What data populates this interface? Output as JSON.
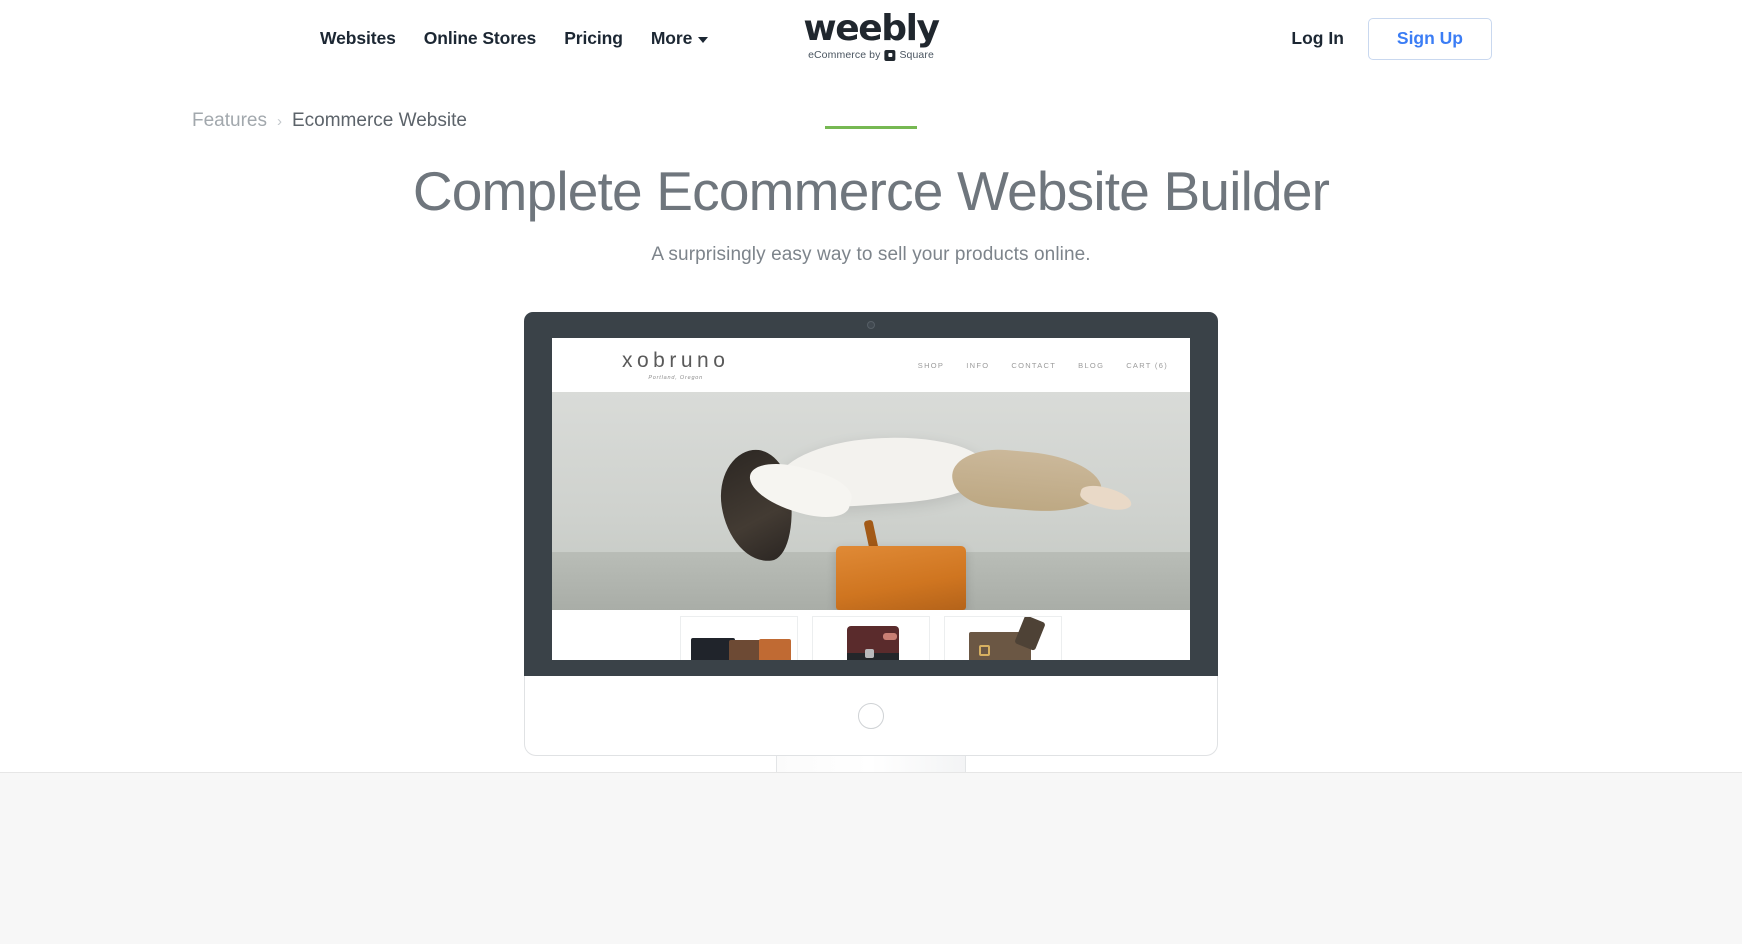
{
  "topnav": {
    "links": [
      {
        "label": "Websites",
        "name": "nav-websites"
      },
      {
        "label": "Online Stores",
        "name": "nav-online-stores"
      },
      {
        "label": "Pricing",
        "name": "nav-pricing"
      }
    ],
    "more_label": "More",
    "login_label": "Log In",
    "signup_label": "Sign Up",
    "signup_color": "#3b7df5"
  },
  "brand": {
    "wordmark": "weebly",
    "tagline_prefix": "eCommerce by",
    "tagline_suffix": "Square"
  },
  "breadcrumb": {
    "parent": "Features",
    "separator": "›",
    "current": "Ecommerce Website"
  },
  "hero": {
    "accent_color": "#76b852",
    "title": "Complete Ecommerce Website Builder",
    "subtitle": "A surprisingly easy way to sell your products online."
  },
  "mockup": {
    "bezel_color": "#3a4248",
    "site": {
      "logo": "xobruno",
      "logo_sub": "Portland, Oregon",
      "nav": [
        {
          "label": "SHOP",
          "name": "store-nav-shop"
        },
        {
          "label": "INFO",
          "name": "store-nav-info"
        },
        {
          "label": "CONTACT",
          "name": "store-nav-contact"
        },
        {
          "label": "BLOG",
          "name": "store-nav-blog"
        },
        {
          "label": "CART (6)",
          "name": "store-nav-cart"
        }
      ],
      "products": [
        {
          "name": "product-thumb-wallets"
        },
        {
          "name": "product-thumb-duffel"
        },
        {
          "name": "product-thumb-messenger"
        }
      ]
    }
  }
}
